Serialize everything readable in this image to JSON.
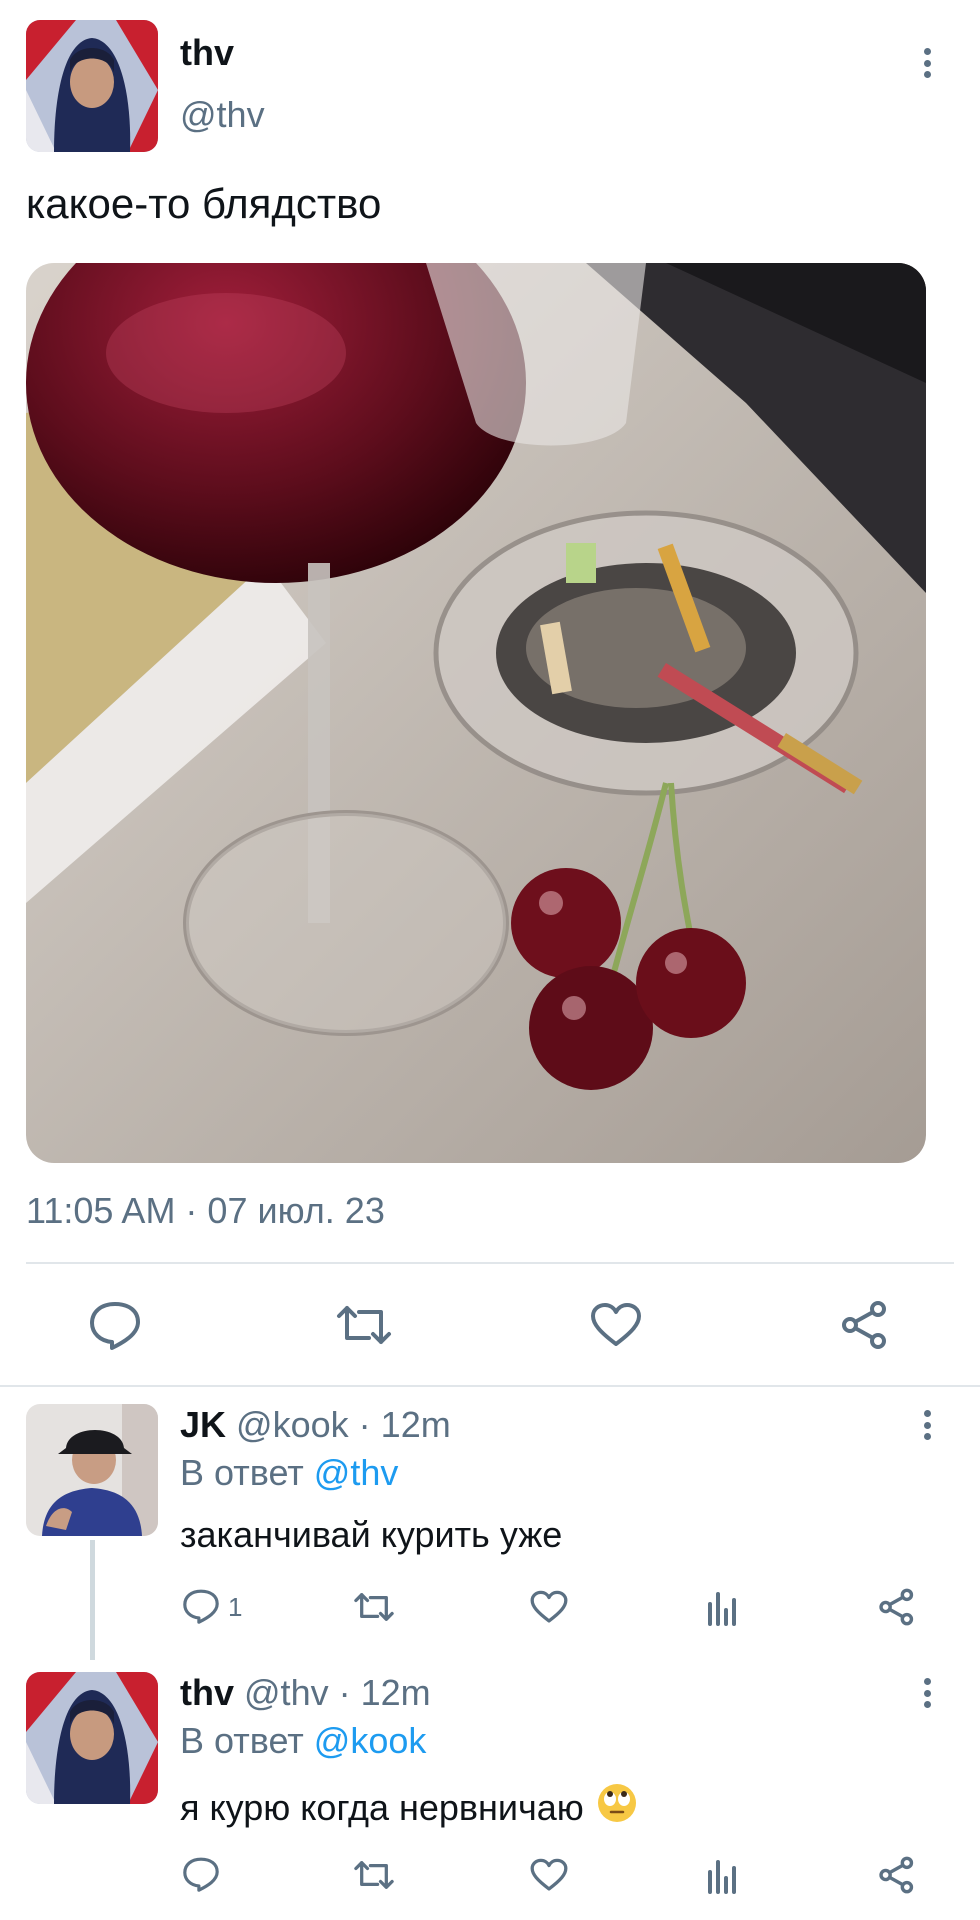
{
  "tweet": {
    "display_name": "thv",
    "handle": "@thv",
    "text": "какое-то блядство",
    "timestamp": "11:05 AM · 07 июл. 23",
    "image_description_icon": "photo-wine-ashtray-cherries"
  },
  "reply1": {
    "display_name": "JK",
    "handle": "@kook",
    "time": "12m",
    "reply_prefix": "В ответ",
    "reply_to": "@thv",
    "text": "заканчивай курить уже",
    "reply_count": "1"
  },
  "reply2": {
    "display_name": "thv",
    "handle": "@thv",
    "time": "12m",
    "reply_prefix": "В ответ",
    "reply_to": "@kook",
    "text": "я курю когда нервничаю"
  },
  "colors": {
    "text": "#0f1419",
    "muted": "#5b7083",
    "link": "#1d9bf0",
    "divider": "#e1e6ea"
  }
}
